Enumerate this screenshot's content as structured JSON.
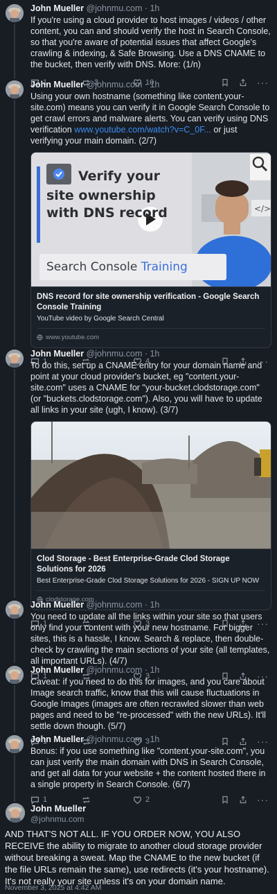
{
  "author": {
    "name": "John Mueller",
    "handle": "@johnmu.com"
  },
  "posts": [
    {
      "time": "1h",
      "text": "If you're using a cloud provider to host images / videos / other content, you can and should verify the host in Search Console, so that you're aware of potential issues that affect Google's crawling & indexing, & Safe Browsing. Use a DNS CNAME to the bucket, then verify with DNS. More: (1/n)",
      "replies": "1",
      "reposts": "3",
      "likes": "10"
    },
    {
      "time": "1h",
      "text_before": "Using your own hostname (something like content.your-site.com) means you can verify it in Google Search Console to get crawl errors and malware alerts. You can verify using DNS verification ",
      "link": "www.youtube.com/watch?v=C_0F...",
      "text_after": " or just verifying your main domain. (2/7)",
      "card": {
        "title": "DNS record for site ownership verification - Google Search Console Training",
        "description": "YouTube video by Google Search Central",
        "domain": "www.youtube.com",
        "thumb_line1": "Verify your",
        "thumb_line2": "site ownership",
        "thumb_line3": "with DNS record",
        "thumb_banner_a": "Search Console ",
        "thumb_banner_b": "Training"
      },
      "replies": "1",
      "reposts": "",
      "likes": "4"
    },
    {
      "time": "1h",
      "text": "To do this, set up a CNAME entry for your domain name and point at your cloud provider's bucket, eg \"content.your-site.com\" uses a CNAME for \"your-bucket.clodstorage.com\" (or \"buckets.clodstorage.com\"). Also, you will have to update all links in your site (ugh, I know). (3/7)",
      "card": {
        "title": "Clod Storage - Best Enterprise-Grade Clod Storage Solutions for 2026",
        "description": "Best Enterprise-Grade Clod Storage Solutions for 2026 - SIGN UP NOW",
        "domain": "clodstorage.com"
      },
      "replies": "1",
      "reposts": "",
      "likes": "3"
    },
    {
      "time": "1h",
      "text": "You need to update all the links within your site so that users only find your content with your new hostname. For bigger sites, this is a hassle, I know. Search & replace, then double-check by crawling the main sections of your site (all templates, all important URLs). (4/7)",
      "replies": "1",
      "reposts": "",
      "likes": "3"
    },
    {
      "time": "1h",
      "text": "Caveat: if you need to do this for images, and you care about Image search traffic, know that this will cause fluctuations in Google Images (images are often recrawled slower than web pages and need to be \"re-processed\" with the new URLs). It'll settle down though. (5/7)",
      "replies": "1",
      "reposts": "",
      "likes": "3"
    },
    {
      "time": "1h",
      "text": "Bonus: if you use something like \"content.your-site.com\", you can just verify the main domain with DNS in Search Console, and get all data for your website + the content hosted there in a single property in Search Console. (6/7)",
      "replies": "1",
      "reposts": "",
      "likes": "2"
    }
  ],
  "main_post": {
    "text": "AND THAT'S NOT ALL. IF YOU ORDER NOW, YOU ALSO RECEIVE the ability to migrate to another cloud storage provider without breaking a sweat. Map the CNAME to the new bucket (if the file URLs remain the same), use redirects (it's your hostname). It's not really your site unless it's on your domain name.",
    "timestamp": "November 3, 2025 at 4:42 AM"
  },
  "separator": " · ",
  "colors": {
    "background": "#181d23",
    "link": "#3b8cf0",
    "muted": "#8b95a3",
    "play_button": "#e53935"
  },
  "icons": [
    "reply-icon",
    "repost-icon",
    "like-icon",
    "bookmark-icon",
    "share-icon",
    "more-icon",
    "globe-icon",
    "play-icon"
  ]
}
